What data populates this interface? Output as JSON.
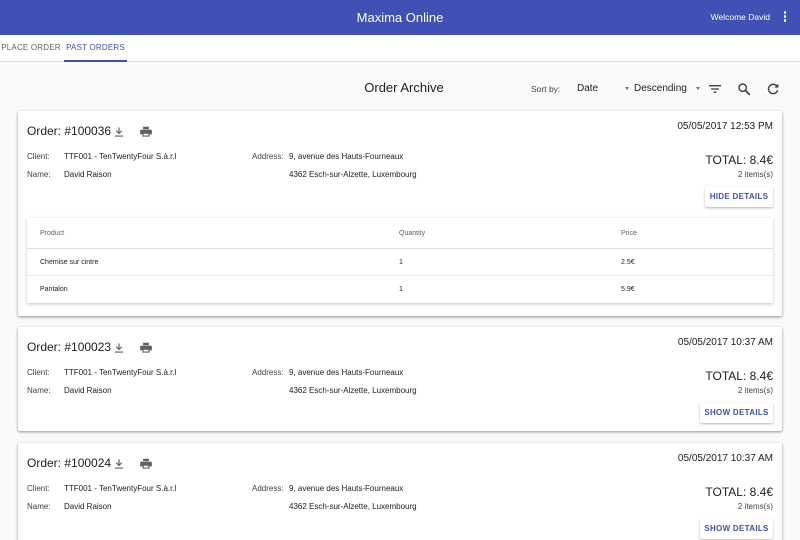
{
  "app": {
    "title": "Maxima Online",
    "welcome": "Welcome David"
  },
  "tabs": [
    {
      "label": "Place Order",
      "active": false
    },
    {
      "label": "Past Orders",
      "active": true
    }
  ],
  "toolbar": {
    "title": "Order Archive",
    "sort_label": "Sort by:",
    "sort_field": "Date",
    "sort_direction": "Descending",
    "icons": [
      "filter-icon",
      "search-icon",
      "refresh-icon"
    ]
  },
  "labels": {
    "client": "Client:",
    "name": "Name:",
    "address": "Address:"
  },
  "table_headers": {
    "product": "Product",
    "quantity": "Quantity",
    "price": "Price"
  },
  "orders": [
    {
      "title": "Order: #100036",
      "date": "05/05/2017 12:53 PM",
      "client": "TTF001 - TenTwentyFour S.à.r.l",
      "name": "David Raison",
      "address_line1": "9, avenue des Hauts-Fourneaux",
      "address_line2": "4362 Esch-sur-Alzette, Luxembourg",
      "total": "TOTAL: 8.4€",
      "items": "2 items(s)",
      "button": "Hide Details",
      "expanded": true,
      "lines": [
        {
          "product": "Chemise sur cintre",
          "quantity": "1",
          "price": "2.5€"
        },
        {
          "product": "Pantalon",
          "quantity": "1",
          "price": "5.9€"
        }
      ]
    },
    {
      "title": "Order: #100023",
      "date": "05/05/2017 10:37 AM",
      "client": "TTF001 - TenTwentyFour S.à.r.l",
      "name": "David Raison",
      "address_line1": "9, avenue des Hauts-Fourneaux",
      "address_line2": "4362 Esch-sur-Alzette, Luxembourg",
      "total": "TOTAL: 8.4€",
      "items": "2 items(s)",
      "button": "Show Details",
      "expanded": false
    },
    {
      "title": "Order: #100024",
      "date": "05/05/2017 10:37 AM",
      "client": "TTF001 - TenTwentyFour S.à.r.l",
      "name": "David Raison",
      "address_line1": "9, avenue des Hauts-Fourneaux",
      "address_line2": "4362 Esch-sur-Alzette, Luxembourg",
      "total": "TOTAL: 8.4€",
      "items": "2 items(s)",
      "button": "Show Details",
      "expanded": false
    }
  ],
  "colors": {
    "primary": "#3f51b5",
    "background": "#fafafa",
    "card": "#ffffff"
  }
}
